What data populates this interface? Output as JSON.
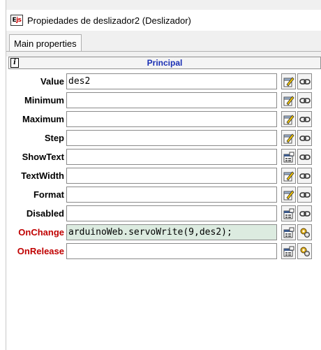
{
  "window": {
    "title": "Propiedades de deslizador2 (Deslizador)",
    "app_icon": "Ej"
  },
  "tabs": [
    {
      "label": "Main properties"
    }
  ],
  "section": {
    "title": "Principal",
    "icon": "i"
  },
  "properties": [
    {
      "label": "Value",
      "value": "des2",
      "label_color": "#000000",
      "icon1": "edit-icon",
      "icon2": "link-icon"
    },
    {
      "label": "Minimum",
      "value": "",
      "label_color": "#000000",
      "icon1": "edit-icon",
      "icon2": "link-icon"
    },
    {
      "label": "Maximum",
      "value": "",
      "label_color": "#000000",
      "icon1": "edit-icon",
      "icon2": "link-icon"
    },
    {
      "label": "Step",
      "value": "",
      "label_color": "#000000",
      "icon1": "edit-icon",
      "icon2": "link-icon"
    },
    {
      "label": "ShowText",
      "value": "",
      "label_color": "#000000",
      "icon1": "properties-icon",
      "icon2": "link-icon"
    },
    {
      "label": "TextWidth",
      "value": "",
      "label_color": "#000000",
      "icon1": "edit-icon",
      "icon2": "link-icon"
    },
    {
      "label": "Format",
      "value": "",
      "label_color": "#000000",
      "icon1": "edit-icon",
      "icon2": "link-icon"
    },
    {
      "label": "Disabled",
      "value": "",
      "label_color": "#000000",
      "icon1": "properties-icon",
      "icon2": "link-icon"
    },
    {
      "label": "OnChange",
      "value": "arduinoWeb.servoWrite(9,des2);",
      "label_color": "#c00000",
      "icon1": "properties-icon",
      "icon2": "gears-icon"
    },
    {
      "label": "OnRelease",
      "value": "",
      "label_color": "#c00000",
      "icon1": "properties-icon",
      "icon2": "gears-icon"
    }
  ]
}
